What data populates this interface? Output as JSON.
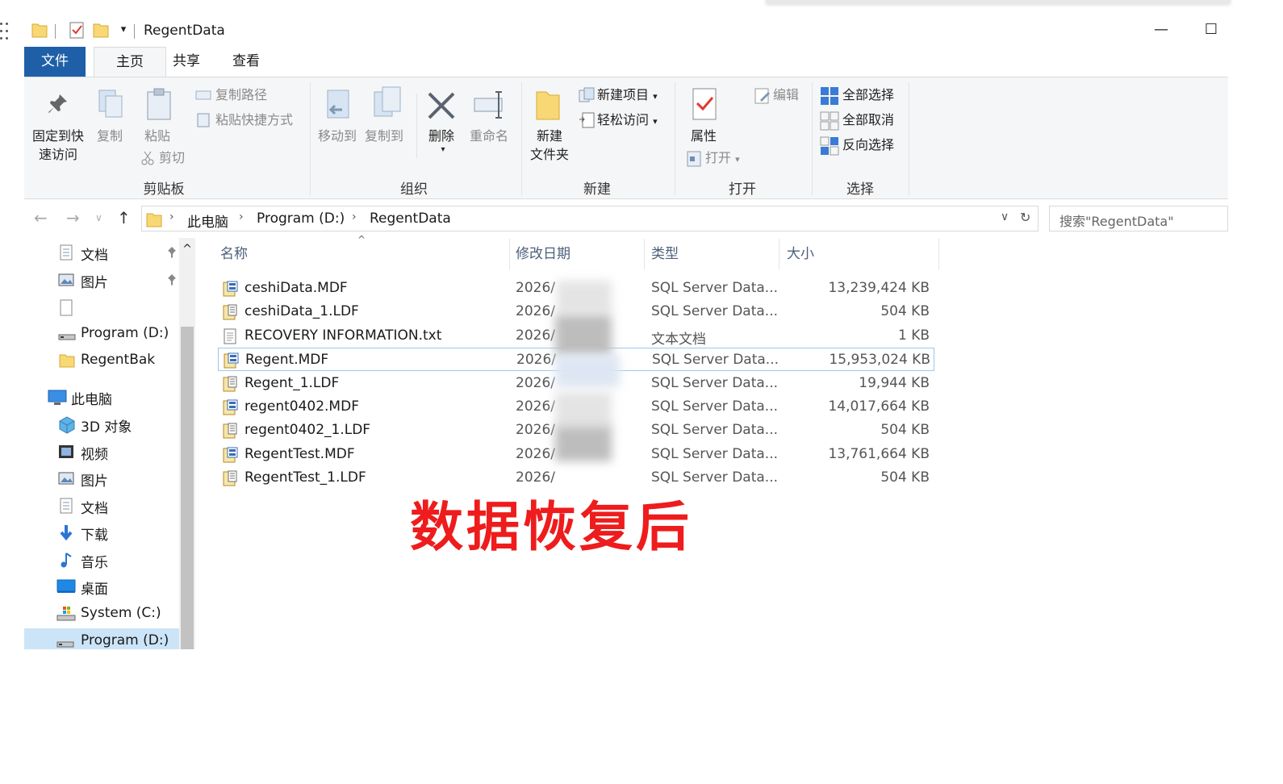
{
  "window": {
    "title": "RegentData",
    "minimize_glyph": "—",
    "maximize_glyph": "☐"
  },
  "ribbon": {
    "tabs": [
      "文件",
      "主页",
      "共享",
      "查看"
    ],
    "clipboard": {
      "group_label": "剪贴板",
      "pin_line1": "固定到快",
      "pin_line2": "速访问",
      "copy": "复制",
      "paste": "粘贴",
      "copy_path": "复制路径",
      "paste_shortcut": "粘贴快捷方式",
      "cut": "剪切"
    },
    "organize": {
      "group_label": "组织",
      "move_to": "移动到",
      "copy_to": "复制到",
      "delete": "删除",
      "rename": "重命名"
    },
    "new": {
      "group_label": "新建",
      "new_folder_line1": "新建",
      "new_folder_line2": "文件夹",
      "new_item": "新建项目",
      "easy_access": "轻松访问"
    },
    "open": {
      "group_label": "打开",
      "properties": "属性",
      "open": "打开",
      "edit": "编辑"
    },
    "select": {
      "group_label": "选择",
      "select_all": "全部选择",
      "select_none": "全部取消",
      "invert": "反向选择"
    }
  },
  "address": {
    "crumbs": [
      "此电脑",
      "Program (D:)",
      "RegentData"
    ],
    "search_placeholder": "搜索\"RegentData\""
  },
  "nav_pane": {
    "items": [
      {
        "label": "文档",
        "icon": "document-icon",
        "pinned": true
      },
      {
        "label": "图片",
        "icon": "pictures-icon",
        "pinned": true
      },
      {
        "label": "",
        "icon": "blank-file-icon",
        "pinned": false
      },
      {
        "label": "Program (D:)",
        "icon": "drive-icon",
        "pinned": false
      },
      {
        "label": "RegentBak",
        "icon": "folder-icon",
        "pinned": false
      },
      {
        "label": "此电脑",
        "icon": "computer-icon",
        "pinned": false
      },
      {
        "label": "3D 对象",
        "icon": "3d-objects-icon",
        "pinned": false
      },
      {
        "label": "视频",
        "icon": "video-icon",
        "pinned": false
      },
      {
        "label": "图片",
        "icon": "pictures-icon",
        "pinned": false
      },
      {
        "label": "文档",
        "icon": "document-icon",
        "pinned": false
      },
      {
        "label": "下载",
        "icon": "download-icon",
        "pinned": false
      },
      {
        "label": "音乐",
        "icon": "music-icon",
        "pinned": false
      },
      {
        "label": "桌面",
        "icon": "desktop-icon",
        "pinned": false
      },
      {
        "label": "System (C:)",
        "icon": "system-drive-icon",
        "pinned": false
      },
      {
        "label": "Program (D:)",
        "icon": "drive-icon",
        "pinned": false
      }
    ]
  },
  "file_list": {
    "columns": [
      "名称",
      "修改日期",
      "类型",
      "大小"
    ],
    "rows": [
      {
        "name": "ceshiData.MDF",
        "date": "2026/",
        "type": "SQL Server Data...",
        "size": "13,239,424 KB",
        "kind": "mdf"
      },
      {
        "name": "ceshiData_1.LDF",
        "date": "2026/",
        "type": "SQL Server Data...",
        "size": "504 KB",
        "kind": "ldf"
      },
      {
        "name": "RECOVERY INFORMATION.txt",
        "date": "2026/",
        "type": "文本文档",
        "size": "1 KB",
        "kind": "txt"
      },
      {
        "name": "Regent.MDF",
        "date": "2026/",
        "type": "SQL Server Data...",
        "size": "15,953,024 KB",
        "kind": "mdf"
      },
      {
        "name": "Regent_1.LDF",
        "date": "2026/",
        "type": "SQL Server Data...",
        "size": "19,944 KB",
        "kind": "ldf"
      },
      {
        "name": "regent0402.MDF",
        "date": "2026/",
        "type": "SQL Server Data...",
        "size": "14,017,664 KB",
        "kind": "mdf"
      },
      {
        "name": "regent0402_1.LDF",
        "date": "2026/",
        "type": "SQL Server Data...",
        "size": "504 KB",
        "kind": "ldf"
      },
      {
        "name": "RegentTest.MDF",
        "date": "2026/",
        "type": "SQL Server Data...",
        "size": "13,761,664 KB",
        "kind": "mdf"
      },
      {
        "name": "RegentTest_1.LDF",
        "date": "2026/",
        "type": "SQL Server Data...",
        "size": "504 KB",
        "kind": "ldf"
      }
    ],
    "selected_index": 3
  },
  "overlay_text": "数据恢复后",
  "colors": {
    "file_tab": "#1f5fa8",
    "overlay": "#ee1c1c",
    "selected_row_border": "#99c9ef",
    "header_text": "#4c607a"
  }
}
